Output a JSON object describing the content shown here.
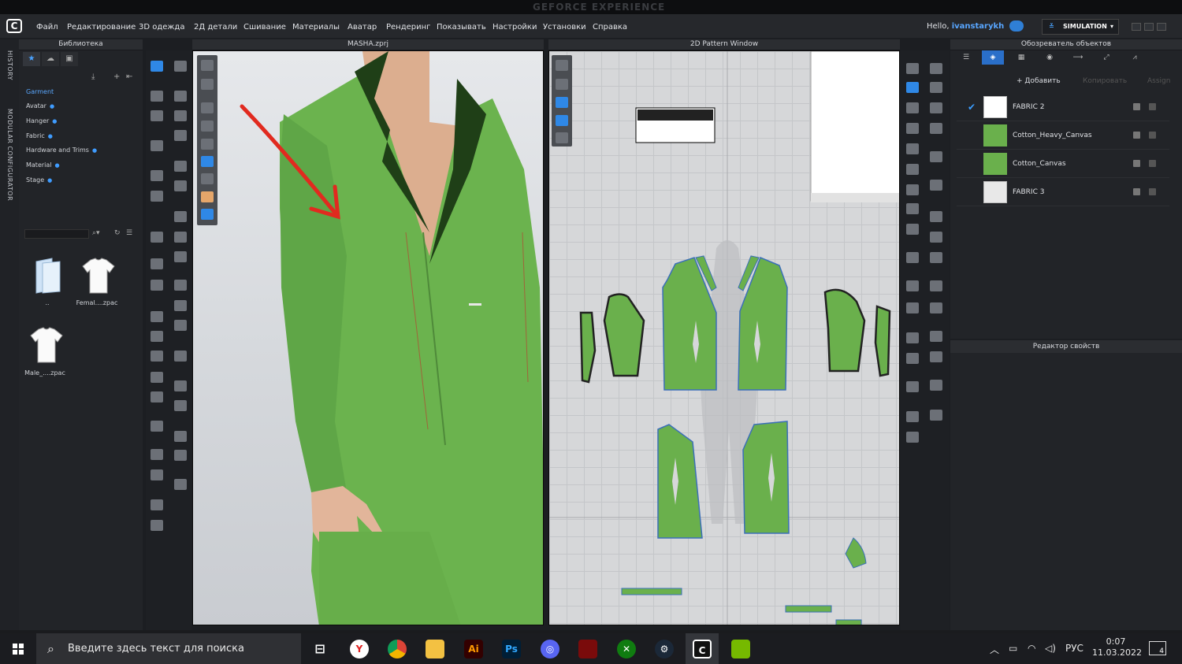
{
  "overlay": {
    "geforce_title": "GEFORCE EXPERIENCE"
  },
  "menubar": {
    "items": [
      "Файл",
      "Редактирование",
      "3D одежда",
      "2Д детали",
      "Сшивание",
      "Материалы",
      "Аватар",
      "Рендеринг",
      "Показывать",
      "Настройки",
      "Установки",
      "Справка"
    ],
    "hello_prefix": "Hello,",
    "username": "ivanstarykh",
    "mode_label": "SIMULATION"
  },
  "history_panel": {
    "history_label": "HISTORY",
    "modular_label": "MODULAR CONFIGURATOR"
  },
  "library": {
    "title": "Библиотека",
    "categories": [
      "Garment",
      "Avatar",
      "Hanger",
      "Fabric",
      "Hardware and Trims",
      "Material",
      "Stage"
    ],
    "selected_category": "Garment",
    "files": [
      {
        "label": "..",
        "icon": "folder-icon"
      },
      {
        "label": "Femal....zpac",
        "icon": "tshirt-icon"
      },
      {
        "label": "Male_....zpac",
        "icon": "tshirt-icon"
      }
    ]
  },
  "view3d": {
    "title": "MASHA.zprj"
  },
  "view2d": {
    "title": "2D Pattern Window"
  },
  "object_browser": {
    "title": "Обозреватель объектов",
    "add_label": "+ Добавить",
    "copy_label": "Копировать",
    "assign_label": "Assign",
    "fabrics": [
      {
        "name": "FABRIC 2",
        "color": "#ffffff",
        "checked": true
      },
      {
        "name": "Cotton_Heavy_Canvas",
        "color": "#6ab04c",
        "checked": false
      },
      {
        "name": "Cotton_Canvas",
        "color": "#6ab04c",
        "checked": false
      },
      {
        "name": "FABRIC 3",
        "color": "#e8e8e8",
        "checked": false
      }
    ]
  },
  "property_editor": {
    "title": "Редактор свойств"
  },
  "taskbar": {
    "search_placeholder": "Введите здесь текст для поиска",
    "apps": [
      "yandex-browser",
      "chrome",
      "file-explorer",
      "illustrator",
      "photoshop",
      "discord",
      "game-app",
      "xbox",
      "steam",
      "clo3d",
      "nvidia"
    ],
    "language": "РУС",
    "time": "0:07",
    "date": "11.03.2022",
    "notification_count": "4"
  },
  "colors": {
    "accent": "#2f88e6",
    "garment": "#6ab04c",
    "annotation_arrow": "#e12a1f"
  }
}
